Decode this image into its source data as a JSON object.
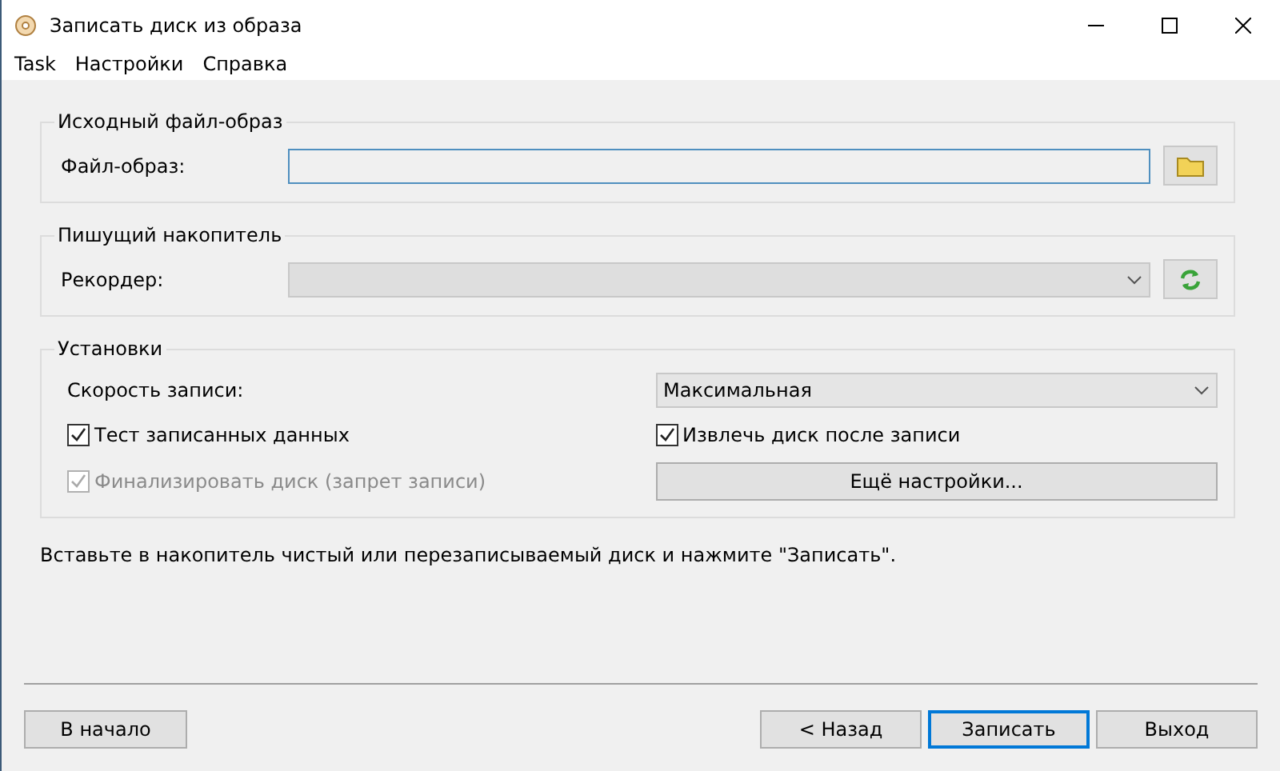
{
  "window": {
    "title": "Записать диск из образа"
  },
  "menu": [
    "Task",
    "Настройки",
    "Справка"
  ],
  "source_group": {
    "title": "Исходный файл-образ",
    "label": "Файл-образ:"
  },
  "recorder_group": {
    "title": "Пишущий накопитель",
    "label": "Рекордер:"
  },
  "settings_group": {
    "title": "Установки",
    "speed_label": "Скорость записи:",
    "speed_value": "Максимальная",
    "checkboxes": [
      {
        "label": "Тест записанных данных",
        "checked": true,
        "disabled": false
      },
      {
        "label": "Извлечь диск после записи",
        "checked": true,
        "disabled": false
      },
      {
        "label": "Финализировать диск (запрет записи)",
        "checked": true,
        "disabled": true
      }
    ],
    "more_button": "Ещё настройки..."
  },
  "hint": "Вставьте в накопитель чистый или перезаписываемый диск и нажмите \"Записать\".",
  "buttons": [
    {
      "label": "В начало",
      "default": false
    },
    {
      "label": "< Назад",
      "default": false
    },
    {
      "label": "Записать",
      "default": true
    },
    {
      "label": "Выход",
      "default": false
    }
  ]
}
